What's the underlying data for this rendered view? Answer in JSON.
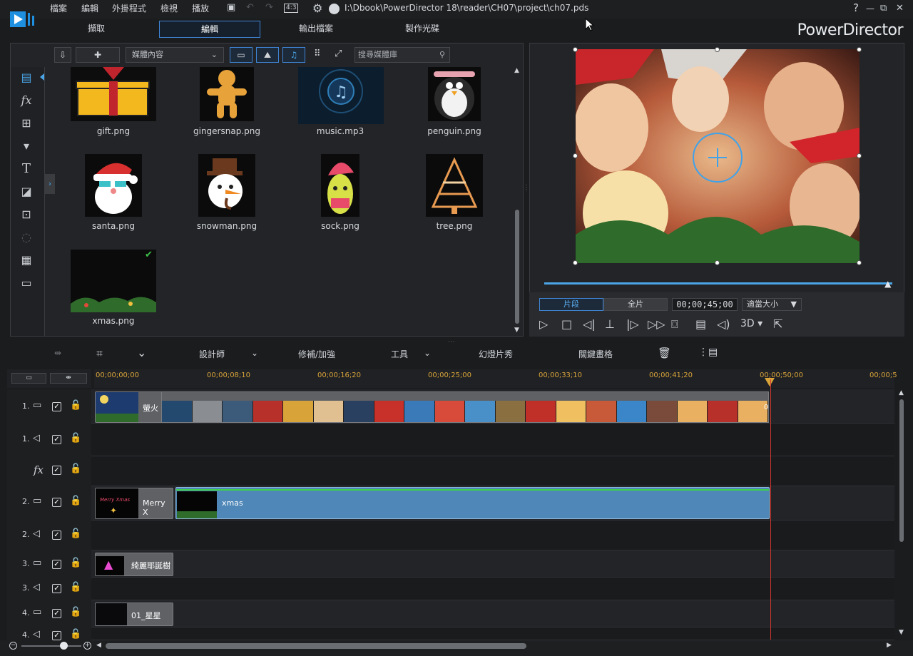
{
  "menu": {
    "file": "檔案",
    "edit": "編輯",
    "plugins": "外掛程式",
    "view": "檢視",
    "playback": "播放",
    "ratio": "4:3"
  },
  "title_path": "I:\\Dbook\\PowerDirector 18\\reader\\CH07\\project\\ch07.pds",
  "window": {
    "help": "?",
    "min": "—",
    "restore": "⧉",
    "close": "✕"
  },
  "modes": {
    "capture": "擷取",
    "edit": "編輯",
    "produce": "輸出檔案",
    "disc": "製作光碟"
  },
  "brand": "PowerDirector",
  "library": {
    "dropdown": "媒體內容",
    "search_placeholder": "搜尋媒體庫",
    "items": [
      {
        "label": "gift.png"
      },
      {
        "label": "gingersnap.png"
      },
      {
        "label": "music.mp3"
      },
      {
        "label": "penguin.png"
      },
      {
        "label": "santa.png"
      },
      {
        "label": "snowman.png"
      },
      {
        "label": "sock.png"
      },
      {
        "label": "tree.png"
      },
      {
        "label": "xmas.png"
      }
    ]
  },
  "preview": {
    "clip_btn": "片段",
    "movie_btn": "全片",
    "timecode": "00;00;45;00",
    "fit": "適當大小",
    "threed": "3D",
    "progress": 0.99
  },
  "edit_toolbar": {
    "designer": "設計師",
    "fix": "修補/加強",
    "tools": "工具",
    "slideshow": "幻燈片秀",
    "keyframe": "關鍵畫格"
  },
  "ruler": [
    "00;00;00;00",
    "00;00;08;10",
    "00;00;16;20",
    "00;00;25;00",
    "00;00;33;10",
    "00;00;41;20",
    "00;00;50;00",
    "00;00;5"
  ],
  "tracks": {
    "t1v": "1.",
    "t1a": "1.",
    "fx": "fx",
    "t2v": "2.",
    "t2a": "2.",
    "t3v": "3.",
    "t3a": "3.",
    "t4v": "4.",
    "t4a": "4."
  },
  "clips": {
    "t1_title": "螢火",
    "t2_title": "Merry X",
    "t2_main": "xmas",
    "t3_title": "綺麗耶誕樹",
    "t4_title": "01_星星",
    "merry_art": "Merry Xmas"
  },
  "colors": {
    "accent": "#3f85d6",
    "playhead": "#d2362f",
    "ruler_text": "#d8a43a",
    "clip_blue": "#4f87b8"
  }
}
